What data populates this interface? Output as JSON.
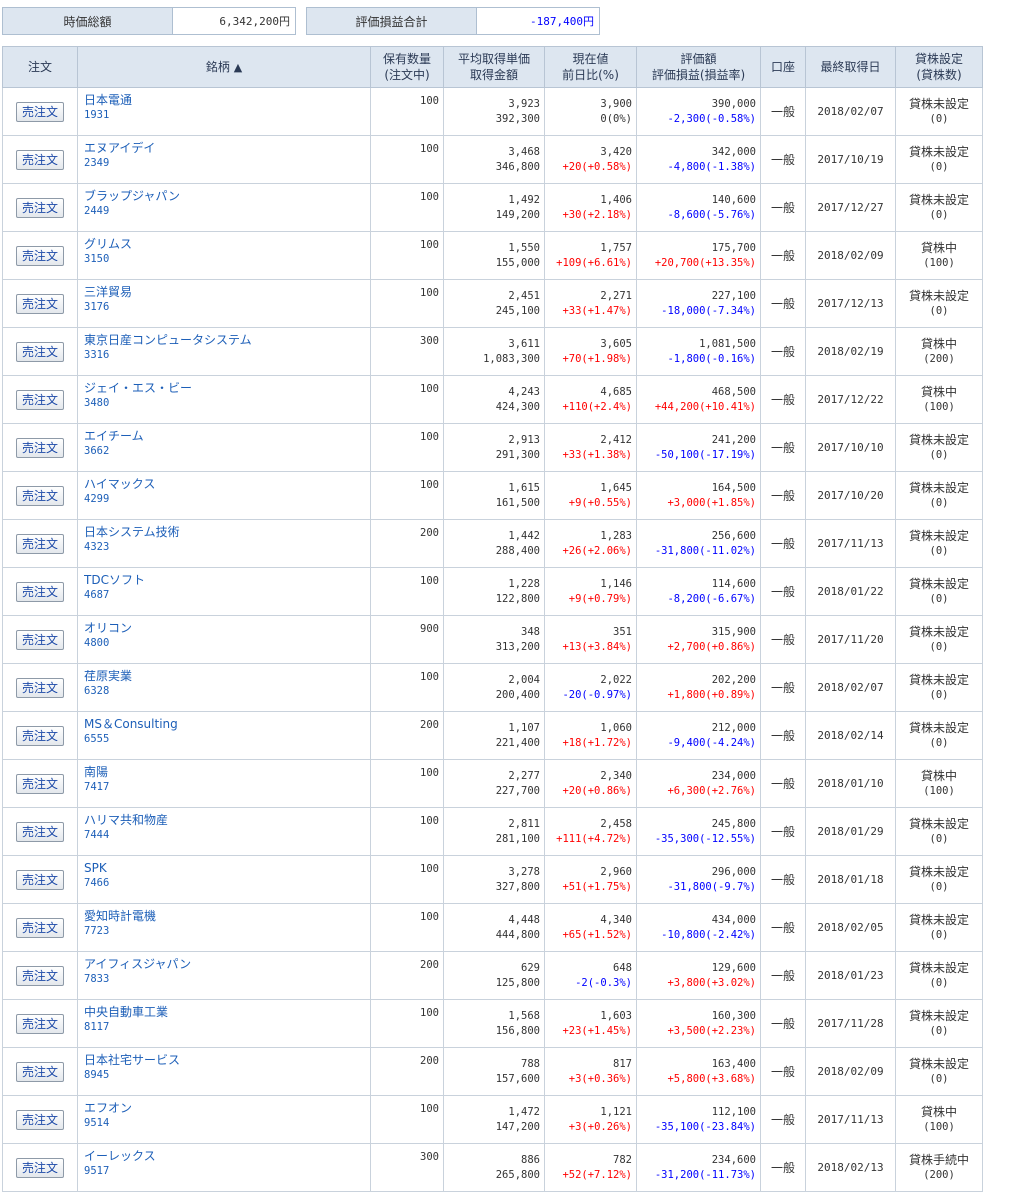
{
  "summary": {
    "market_value_label": "時価総額",
    "market_value": "6,342,200円",
    "pl_label": "評価損益合計",
    "pl_value": "-187,400円"
  },
  "headers": {
    "order": "注文",
    "name": "銘柄",
    "name_sort": "▲",
    "qty1": "保有数量",
    "qty2": "(注文中)",
    "avg1": "平均取得単価",
    "avg2": "取得金額",
    "cur1": "現在値",
    "cur2": "前日比(%)",
    "val1": "評価額",
    "val2": "評価損益(損益率)",
    "acct": "口座",
    "date": "最終取得日",
    "lend1": "貸株設定",
    "lend2": "(貸株数)"
  },
  "sell_label": "売注文",
  "rows": [
    {
      "name": "日本電通",
      "code": "1931",
      "qty": "100",
      "avg": "3,923",
      "cost": "392,300",
      "price": "3,900",
      "chg": "0(0%)",
      "chg_sign": "zero",
      "value": "390,000",
      "pl": "-2,300(-0.58%)",
      "pl_sign": "neg",
      "acct": "一般",
      "date": "2018/02/07",
      "lend": "貸株未設定",
      "lend_n": "(0)"
    },
    {
      "name": "エヌアイデイ",
      "code": "2349",
      "qty": "100",
      "avg": "3,468",
      "cost": "346,800",
      "price": "3,420",
      "chg": "+20(+0.58%)",
      "chg_sign": "pos",
      "value": "342,000",
      "pl": "-4,800(-1.38%)",
      "pl_sign": "neg",
      "acct": "一般",
      "date": "2017/10/19",
      "lend": "貸株未設定",
      "lend_n": "(0)"
    },
    {
      "name": "ブラップジャパン",
      "code": "2449",
      "qty": "100",
      "avg": "1,492",
      "cost": "149,200",
      "price": "1,406",
      "chg": "+30(+2.18%)",
      "chg_sign": "pos",
      "value": "140,600",
      "pl": "-8,600(-5.76%)",
      "pl_sign": "neg",
      "acct": "一般",
      "date": "2017/12/27",
      "lend": "貸株未設定",
      "lend_n": "(0)"
    },
    {
      "name": "グリムス",
      "code": "3150",
      "qty": "100",
      "avg": "1,550",
      "cost": "155,000",
      "price": "1,757",
      "chg": "+109(+6.61%)",
      "chg_sign": "pos",
      "value": "175,700",
      "pl": "+20,700(+13.35%)",
      "pl_sign": "pos",
      "acct": "一般",
      "date": "2018/02/09",
      "lend": "貸株中",
      "lend_n": "(100)"
    },
    {
      "name": "三洋貿易",
      "code": "3176",
      "qty": "100",
      "avg": "2,451",
      "cost": "245,100",
      "price": "2,271",
      "chg": "+33(+1.47%)",
      "chg_sign": "pos",
      "value": "227,100",
      "pl": "-18,000(-7.34%)",
      "pl_sign": "neg",
      "acct": "一般",
      "date": "2017/12/13",
      "lend": "貸株未設定",
      "lend_n": "(0)"
    },
    {
      "name": "東京日産コンピュータシステム",
      "code": "3316",
      "qty": "300",
      "avg": "3,611",
      "cost": "1,083,300",
      "price": "3,605",
      "chg": "+70(+1.98%)",
      "chg_sign": "pos",
      "value": "1,081,500",
      "pl": "-1,800(-0.16%)",
      "pl_sign": "neg",
      "acct": "一般",
      "date": "2018/02/19",
      "lend": "貸株中",
      "lend_n": "(200)"
    },
    {
      "name": "ジェイ・エス・ビー",
      "code": "3480",
      "qty": "100",
      "avg": "4,243",
      "cost": "424,300",
      "price": "4,685",
      "chg": "+110(+2.4%)",
      "chg_sign": "pos",
      "value": "468,500",
      "pl": "+44,200(+10.41%)",
      "pl_sign": "pos",
      "acct": "一般",
      "date": "2017/12/22",
      "lend": "貸株中",
      "lend_n": "(100)"
    },
    {
      "name": "エイチーム",
      "code": "3662",
      "qty": "100",
      "avg": "2,913",
      "cost": "291,300",
      "price": "2,412",
      "chg": "+33(+1.38%)",
      "chg_sign": "pos",
      "value": "241,200",
      "pl": "-50,100(-17.19%)",
      "pl_sign": "neg",
      "acct": "一般",
      "date": "2017/10/10",
      "lend": "貸株未設定",
      "lend_n": "(0)"
    },
    {
      "name": "ハイマックス",
      "code": "4299",
      "qty": "100",
      "avg": "1,615",
      "cost": "161,500",
      "price": "1,645",
      "chg": "+9(+0.55%)",
      "chg_sign": "pos",
      "value": "164,500",
      "pl": "+3,000(+1.85%)",
      "pl_sign": "pos",
      "acct": "一般",
      "date": "2017/10/20",
      "lend": "貸株未設定",
      "lend_n": "(0)"
    },
    {
      "name": "日本システム技術",
      "code": "4323",
      "qty": "200",
      "avg": "1,442",
      "cost": "288,400",
      "price": "1,283",
      "chg": "+26(+2.06%)",
      "chg_sign": "pos",
      "value": "256,600",
      "pl": "-31,800(-11.02%)",
      "pl_sign": "neg",
      "acct": "一般",
      "date": "2017/11/13",
      "lend": "貸株未設定",
      "lend_n": "(0)"
    },
    {
      "name": "TDCソフト",
      "code": "4687",
      "qty": "100",
      "avg": "1,228",
      "cost": "122,800",
      "price": "1,146",
      "chg": "+9(+0.79%)",
      "chg_sign": "pos",
      "value": "114,600",
      "pl": "-8,200(-6.67%)",
      "pl_sign": "neg",
      "acct": "一般",
      "date": "2018/01/22",
      "lend": "貸株未設定",
      "lend_n": "(0)"
    },
    {
      "name": "オリコン",
      "code": "4800",
      "qty": "900",
      "avg": "348",
      "cost": "313,200",
      "price": "351",
      "chg": "+13(+3.84%)",
      "chg_sign": "pos",
      "value": "315,900",
      "pl": "+2,700(+0.86%)",
      "pl_sign": "pos",
      "acct": "一般",
      "date": "2017/11/20",
      "lend": "貸株未設定",
      "lend_n": "(0)"
    },
    {
      "name": "荏原実業",
      "code": "6328",
      "qty": "100",
      "avg": "2,004",
      "cost": "200,400",
      "price": "2,022",
      "chg": "-20(-0.97%)",
      "chg_sign": "neg",
      "value": "202,200",
      "pl": "+1,800(+0.89%)",
      "pl_sign": "pos",
      "acct": "一般",
      "date": "2018/02/07",
      "lend": "貸株未設定",
      "lend_n": "(0)"
    },
    {
      "name": "MS＆Consulting",
      "code": "6555",
      "qty": "200",
      "avg": "1,107",
      "cost": "221,400",
      "price": "1,060",
      "chg": "+18(+1.72%)",
      "chg_sign": "pos",
      "value": "212,000",
      "pl": "-9,400(-4.24%)",
      "pl_sign": "neg",
      "acct": "一般",
      "date": "2018/02/14",
      "lend": "貸株未設定",
      "lend_n": "(0)"
    },
    {
      "name": "南陽",
      "code": "7417",
      "qty": "100",
      "avg": "2,277",
      "cost": "227,700",
      "price": "2,340",
      "chg": "+20(+0.86%)",
      "chg_sign": "pos",
      "value": "234,000",
      "pl": "+6,300(+2.76%)",
      "pl_sign": "pos",
      "acct": "一般",
      "date": "2018/01/10",
      "lend": "貸株中",
      "lend_n": "(100)"
    },
    {
      "name": "ハリマ共和物産",
      "code": "7444",
      "qty": "100",
      "avg": "2,811",
      "cost": "281,100",
      "price": "2,458",
      "chg": "+111(+4.72%)",
      "chg_sign": "pos",
      "value": "245,800",
      "pl": "-35,300(-12.55%)",
      "pl_sign": "neg",
      "acct": "一般",
      "date": "2018/01/29",
      "lend": "貸株未設定",
      "lend_n": "(0)"
    },
    {
      "name": "SPK",
      "code": "7466",
      "qty": "100",
      "avg": "3,278",
      "cost": "327,800",
      "price": "2,960",
      "chg": "+51(+1.75%)",
      "chg_sign": "pos",
      "value": "296,000",
      "pl": "-31,800(-9.7%)",
      "pl_sign": "neg",
      "acct": "一般",
      "date": "2018/01/18",
      "lend": "貸株未設定",
      "lend_n": "(0)"
    },
    {
      "name": "愛知時計電機",
      "code": "7723",
      "qty": "100",
      "avg": "4,448",
      "cost": "444,800",
      "price": "4,340",
      "chg": "+65(+1.52%)",
      "chg_sign": "pos",
      "value": "434,000",
      "pl": "-10,800(-2.42%)",
      "pl_sign": "neg",
      "acct": "一般",
      "date": "2018/02/05",
      "lend": "貸株未設定",
      "lend_n": "(0)"
    },
    {
      "name": "アイフィスジャパン",
      "code": "7833",
      "qty": "200",
      "avg": "629",
      "cost": "125,800",
      "price": "648",
      "chg": "-2(-0.3%)",
      "chg_sign": "neg",
      "value": "129,600",
      "pl": "+3,800(+3.02%)",
      "pl_sign": "pos",
      "acct": "一般",
      "date": "2018/01/23",
      "lend": "貸株未設定",
      "lend_n": "(0)"
    },
    {
      "name": "中央自動車工業",
      "code": "8117",
      "qty": "100",
      "avg": "1,568",
      "cost": "156,800",
      "price": "1,603",
      "chg": "+23(+1.45%)",
      "chg_sign": "pos",
      "value": "160,300",
      "pl": "+3,500(+2.23%)",
      "pl_sign": "pos",
      "acct": "一般",
      "date": "2017/11/28",
      "lend": "貸株未設定",
      "lend_n": "(0)"
    },
    {
      "name": "日本社宅サービス",
      "code": "8945",
      "qty": "200",
      "avg": "788",
      "cost": "157,600",
      "price": "817",
      "chg": "+3(+0.36%)",
      "chg_sign": "pos",
      "value": "163,400",
      "pl": "+5,800(+3.68%)",
      "pl_sign": "pos",
      "acct": "一般",
      "date": "2018/02/09",
      "lend": "貸株未設定",
      "lend_n": "(0)"
    },
    {
      "name": "エフオン",
      "code": "9514",
      "qty": "100",
      "avg": "1,472",
      "cost": "147,200",
      "price": "1,121",
      "chg": "+3(+0.26%)",
      "chg_sign": "pos",
      "value": "112,100",
      "pl": "-35,100(-23.84%)",
      "pl_sign": "neg",
      "acct": "一般",
      "date": "2017/11/13",
      "lend": "貸株中",
      "lend_n": "(100)"
    },
    {
      "name": "イーレックス",
      "code": "9517",
      "qty": "300",
      "avg": "886",
      "cost": "265,800",
      "price": "782",
      "chg": "+52(+7.12%)",
      "chg_sign": "pos",
      "value": "234,600",
      "pl": "-31,200(-11.73%)",
      "pl_sign": "neg",
      "acct": "一般",
      "date": "2018/02/13",
      "lend": "貸株手続中",
      "lend_n": "(200)"
    }
  ]
}
